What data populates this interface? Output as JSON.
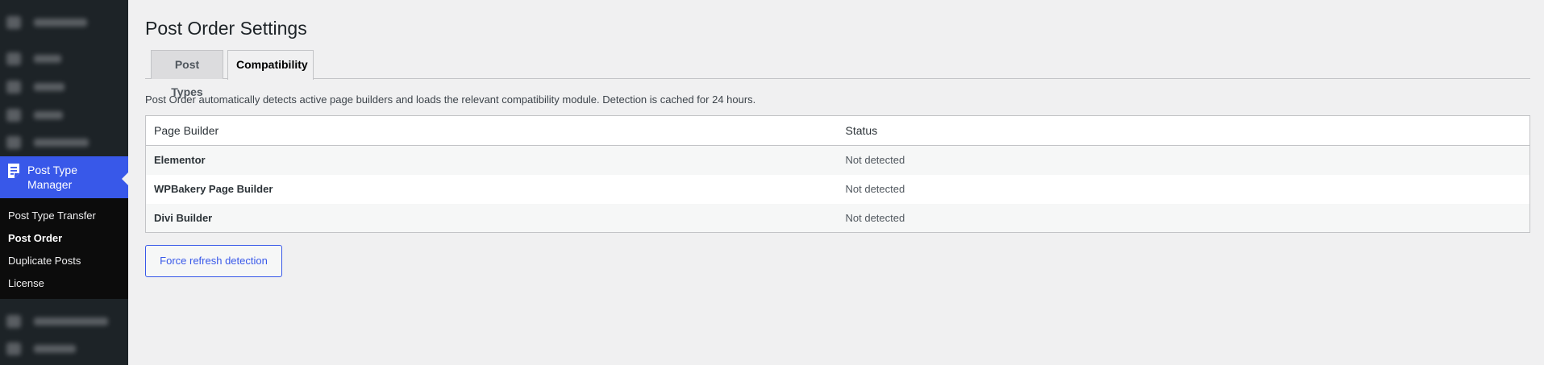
{
  "sidebar": {
    "current_menu_label": "Post Type Manager",
    "submenu": [
      {
        "label": "Post Type Transfer",
        "current": false
      },
      {
        "label": "Post Order",
        "current": true
      },
      {
        "label": "Duplicate Posts",
        "current": false
      },
      {
        "label": "License",
        "current": false
      }
    ],
    "accent_color": "#3858e9"
  },
  "page": {
    "title": "Post Order Settings",
    "tabs": [
      {
        "label": "Post Types",
        "active": false
      },
      {
        "label": "Compatibility",
        "active": true
      }
    ],
    "description": "Post Order automatically detects active page builders and loads the relevant compatibility module. Detection is cached for 24 hours.",
    "table": {
      "headers": [
        "Page Builder",
        "Status"
      ],
      "rows": [
        {
          "builder": "Elementor",
          "status": "Not detected"
        },
        {
          "builder": "WPBakery Page Builder",
          "status": "Not detected"
        },
        {
          "builder": "Divi Builder",
          "status": "Not detected"
        }
      ]
    },
    "refresh_button_label": "Force refresh detection"
  }
}
